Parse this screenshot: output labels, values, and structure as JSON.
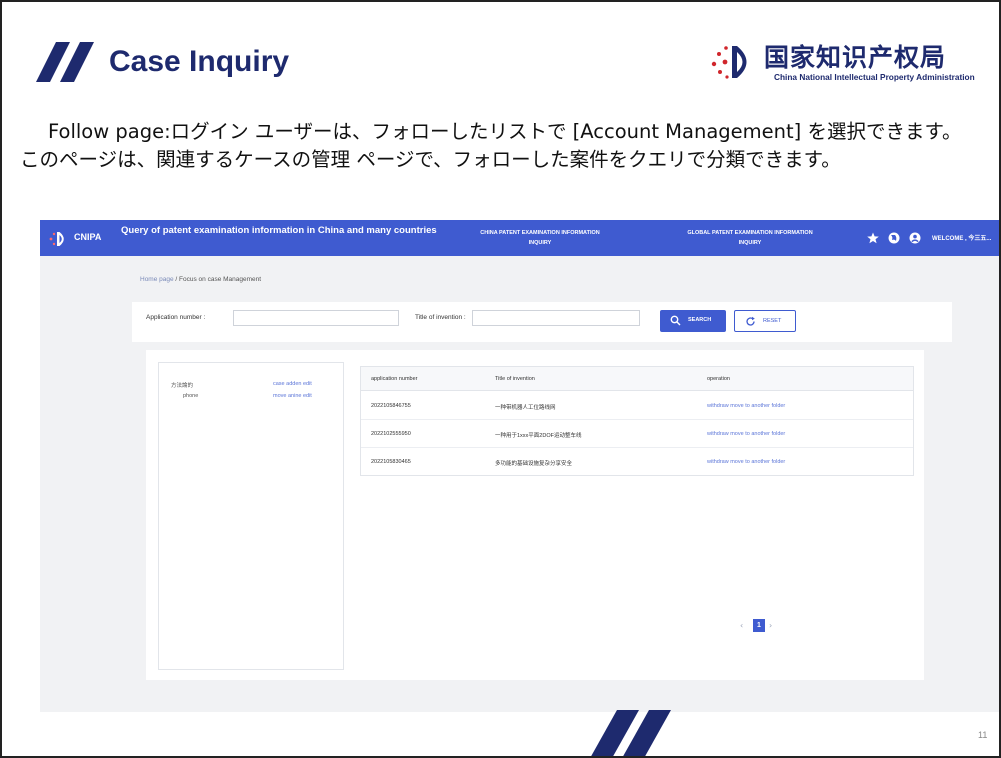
{
  "slide": {
    "title": "Case Inquiry",
    "logo_cn": "国家知识产权局",
    "logo_en": "China National Intellectual Property Administration",
    "description": "Follow page:ログイン ユーザーは、フォローしたリストで [Account Management] を選択できます。このページは、関連するケースの管理 ページで、フォローした案件をクエリで分類できます。",
    "page_number": "11"
  },
  "app": {
    "brand": "CNIPA",
    "title": "Query of patent examination information in China and many countries",
    "nav": [
      {
        "label": "CHINA PATENT EXAMINATION INFORMATION INQUIRY"
      },
      {
        "label": "GLOBAL PATENT EXAMINATION INFORMATION INQUIRY"
      }
    ],
    "welcome": "WELCOME , 今三五..."
  },
  "breadcrumb": {
    "home": "Home page",
    "separator": "/",
    "current": "Focus on case Management"
  },
  "search": {
    "app_label": "Application number :",
    "title_label": "Title of invention :",
    "search_button": "SEARCH",
    "reset_button": "RESET"
  },
  "tree": {
    "items": [
      {
        "label": "方法論的",
        "actions": "case adden  edit"
      },
      {
        "label": "phone",
        "actions": "move anine  edit"
      }
    ]
  },
  "table": {
    "headers": [
      "application number",
      "Title of invention",
      "operation"
    ],
    "rows": [
      {
        "number": "2022105846755",
        "title": "一种带机器人工位路线网",
        "operation": "withdraw   move to another folder"
      },
      {
        "number": "2022102555950",
        "title": "一种用于1xxx平面2DOF运动整车线",
        "operation": "withdraw   move to another folder"
      },
      {
        "number": "2022105830465",
        "title": "多功能的基础设施复杂分享安全",
        "operation": "withdraw   move to another folder"
      }
    ]
  },
  "pagination": {
    "prev": "‹",
    "current": "1",
    "next": "›"
  },
  "colors": {
    "brand_blue": "#3f5bd0",
    "title_navy": "#1e2a6e",
    "logo_red": "#d0262c"
  }
}
